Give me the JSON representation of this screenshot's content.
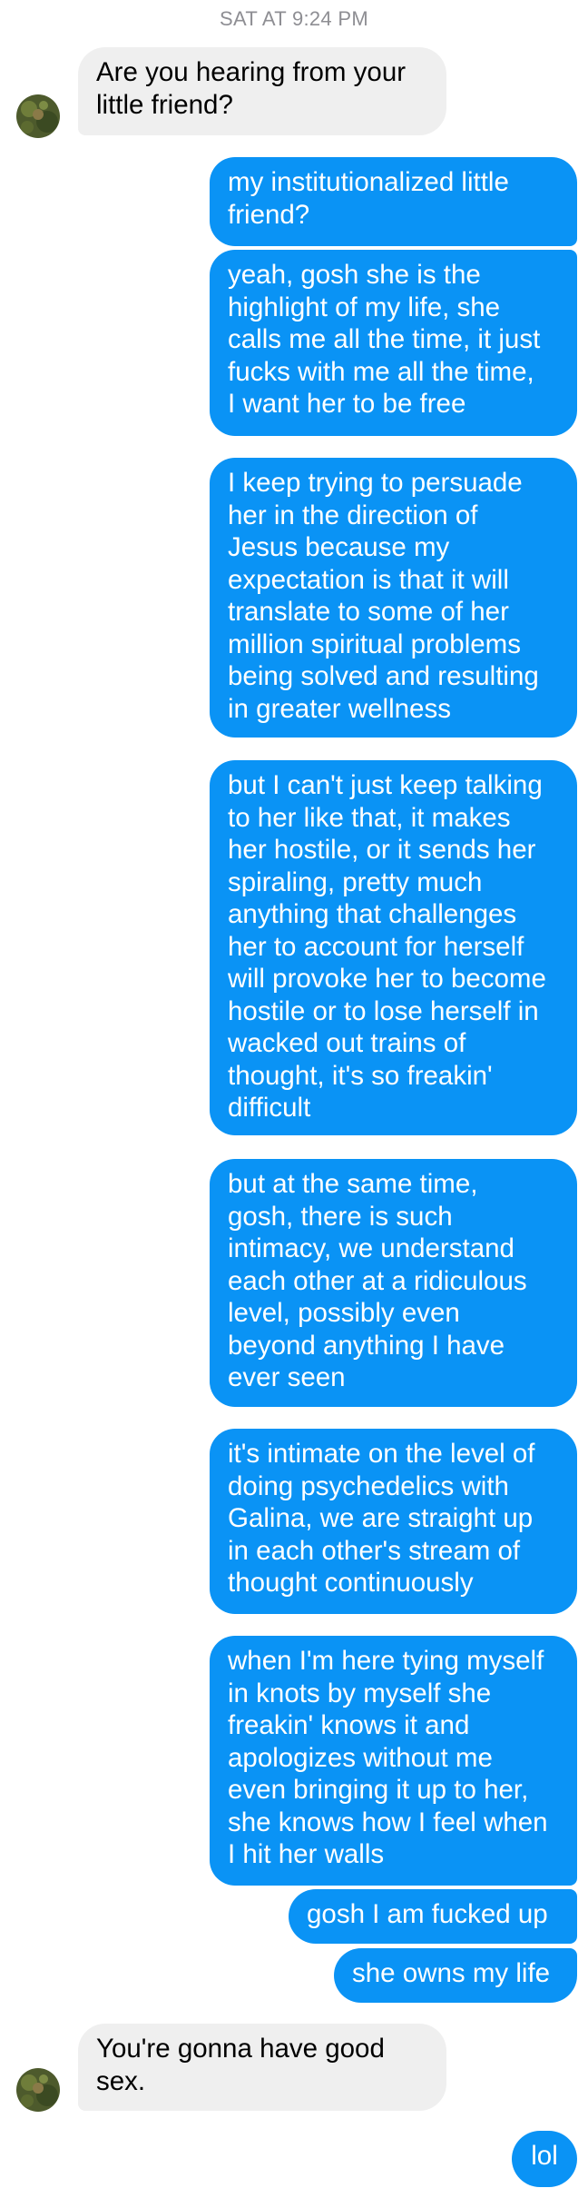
{
  "conversation": {
    "timestamp": "SAT AT 9:24 PM",
    "messages": [
      {
        "from": "them",
        "text": "Are you hearing from your\nlittle friend?"
      },
      {
        "from": "me",
        "text": "my institutionalized little\nfriend?"
      },
      {
        "from": "me",
        "text": "yeah, gosh she is the\nhighlight of my life, she\ncalls me all the time, it just\nfucks with me all the time,\nI want her to be free"
      },
      {
        "from": "me",
        "text": "I keep trying to persuade\nher in the direction of\nJesus because my\nexpectation is that it will\ntranslate to some of her\nmillion spiritual problems\nbeing solved and resulting\nin greater wellness"
      },
      {
        "from": "me",
        "text": "but I can't just keep talking\nto her like that, it makes\nher hostile, or it sends her\nspiraling, pretty much\nanything that challenges\nher to account for herself\nwill provoke her to become\nhostile or to lose herself in\nwacked out trains of\nthought, it's so freakin'\ndifficult"
      },
      {
        "from": "me",
        "text": "but at the same time,\ngosh, there is such\nintimacy, we understand\neach other at a ridiculous\nlevel, possibly even\nbeyond anything I have\never seen"
      },
      {
        "from": "me",
        "text": "it's intimate on the level of\ndoing psychedelics with\nGalina, we are straight up\nin each other's stream of\nthought continuously"
      },
      {
        "from": "me",
        "text": "when I'm here tying myself\nin knots by myself she\nfreakin' knows it and\napologizes without me\neven bringing it up to her,\nshe knows how I feel when\nI hit her walls"
      },
      {
        "from": "me",
        "text": "gosh I am fucked up"
      },
      {
        "from": "me",
        "text": "she owns my life"
      },
      {
        "from": "them",
        "text": "You're gonna have good\nsex."
      },
      {
        "from": "me",
        "text": "lol"
      }
    ]
  },
  "colors": {
    "outgoing_bubble": "#0a93f5",
    "incoming_bubble": "#efefef",
    "timestamp_text": "#8e8e93"
  },
  "icons": {
    "avatar": "contact-avatar-photo"
  }
}
